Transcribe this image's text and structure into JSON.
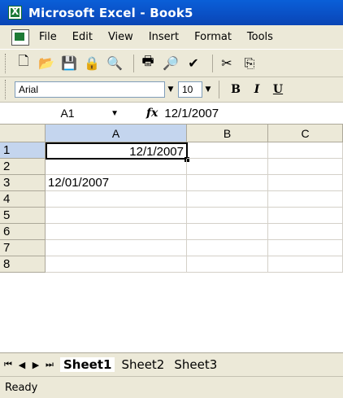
{
  "window": {
    "title": "Microsoft Excel - Book5"
  },
  "menu": {
    "items": [
      "File",
      "Edit",
      "View",
      "Insert",
      "Format",
      "Tools"
    ]
  },
  "toolbar": {
    "icons": [
      "new-icon",
      "open-icon",
      "save-icon",
      "permission-icon",
      "research-icon",
      "print-icon",
      "print-preview-icon",
      "spelling-icon",
      "cut-icon",
      "copy-icon"
    ]
  },
  "format_bar": {
    "font": "Arial",
    "size": "10",
    "bold": "B",
    "italic": "I",
    "underline": "U"
  },
  "formula_bar": {
    "name_box": "A1",
    "fx": "fx",
    "content": "12/1/2007"
  },
  "sheet": {
    "columns": [
      "A",
      "B",
      "C"
    ],
    "rows": [
      "1",
      "2",
      "3",
      "4",
      "5",
      "6",
      "7",
      "8"
    ],
    "cells": {
      "A1": "12/1/2007",
      "A3": "12/01/2007"
    }
  },
  "tabs": [
    "Sheet1",
    "Sheet2",
    "Sheet3"
  ],
  "status": "Ready",
  "colors": {
    "title_blue": "#0a5fd8",
    "selection": "#c4d5ee"
  }
}
